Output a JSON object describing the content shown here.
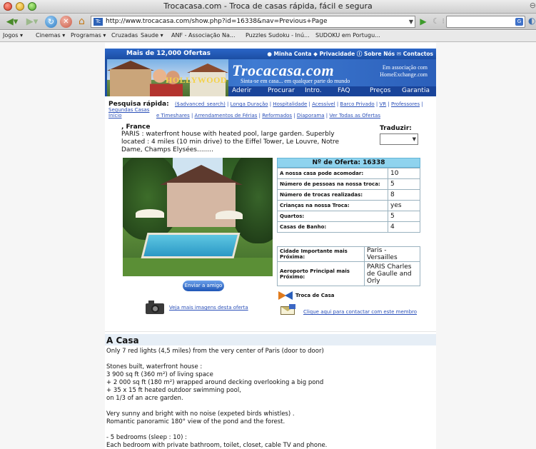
{
  "browser": {
    "window_title": "Trocacasa.com - Troca de casas rápida, fácil e segura",
    "url": "http://www.trocacasa.com/show.php?id=16338&nav=Previous+Page",
    "bookmarks": [
      "Jogos ▾",
      "Cinemas ▾",
      "Programas ▾",
      "Cruzadas",
      "Saude ▾",
      "ANF - Associação Na...",
      "Puzzles Sudoku - Inú...",
      "SUDOKU em Portugu..."
    ]
  },
  "banner": {
    "offers": "Mais de 12,000 Ofertas",
    "account": "Minha Conta",
    "privacy": "Privacidade",
    "about": "Sobre Nós",
    "contacts": "Contactos",
    "hollywood": "HOLLYWOOD",
    "brand": "Trocacasa.com",
    "tagline": "Sinta-se em casa... em qualquer parte do mundo",
    "assoc_line1": "Em associação com",
    "assoc_line2": "HomeExchange.com",
    "nav": [
      "Aderir",
      "Procurar",
      "Intro.",
      "FAQ",
      "Preços",
      "Garantia"
    ]
  },
  "quick_search": {
    "label": "Pesquisa rápida:",
    "links": [
      "($advanced_search)",
      "Longa Duração",
      "Hospitalidade",
      "Acessível",
      "Barco Privado",
      "VR",
      "Professores",
      "Segundas Casas",
      "Início",
      "e Timeshares",
      "Arrendamentos de Férias",
      "Reformados",
      "Diaporama",
      "Ver Todas as Ofertas"
    ]
  },
  "listing": {
    "location": ", France",
    "description": "PARIS : waterfront house with heated pool, large garden. Superbly located : 4 miles (10 min drive) to the Eiffel Tower, Le Louvre, Notre Dame, Champs Elysées........",
    "translate_label": "Traduzir:",
    "send_friend": "Enviar a amigo",
    "more_images": "Veja mais imagens desta oferta",
    "troca_label": "Troca de Casa",
    "contact_link": "Clique aqui para contactar com este membro"
  },
  "offer": {
    "title": "Nº de Oferta: 16338",
    "rows": [
      {
        "label": "A nossa casa pode acomodar:",
        "value": "10"
      },
      {
        "label": "Número de pessoas na nossa troca:",
        "value": "5"
      },
      {
        "label": "Número de trocas realizadas:",
        "value": "8"
      },
      {
        "label": "Crianças na nossa Troca:",
        "value": "yes"
      },
      {
        "label": "Quartos:",
        "value": "5"
      },
      {
        "label": "Casas de Banho:",
        "value": "4"
      }
    ],
    "city_label": "Cidade Importante mais Próxima:",
    "city_value": "Paris - Versailles",
    "airport_label": "Aeroporto Principal mais Próximo:",
    "airport_value": "PARIS Charles de Gaulle and Orly"
  },
  "house": {
    "heading": "A Casa",
    "p1": "Only 7 red lights (4,5 miles) from the very center of Paris (door to door)",
    "p2_l1": "Stones built, waterfront house :",
    "p2_l2": "3 900 sq ft (360 m²) of living space",
    "p2_l3": "+ 2 000 sq ft (180 m²) wrapped around decking overlooking a big pond",
    "p2_l4": "+ 35 x 15 ft heated outdoor swimming pool,",
    "p2_l5": "on 1/3 of an acre garden.",
    "p3_l1": "Very sunny and bright with no noise (expeted birds whistles) .",
    "p3_l2": "Romantic panoramic 180° view of the pond and the forest.",
    "p4_l1": "- 5 bedrooms (sleep : 10) :",
    "p4_l2": "Each bedroom with private bathroom, toilet, closet, cable TV and phone."
  }
}
